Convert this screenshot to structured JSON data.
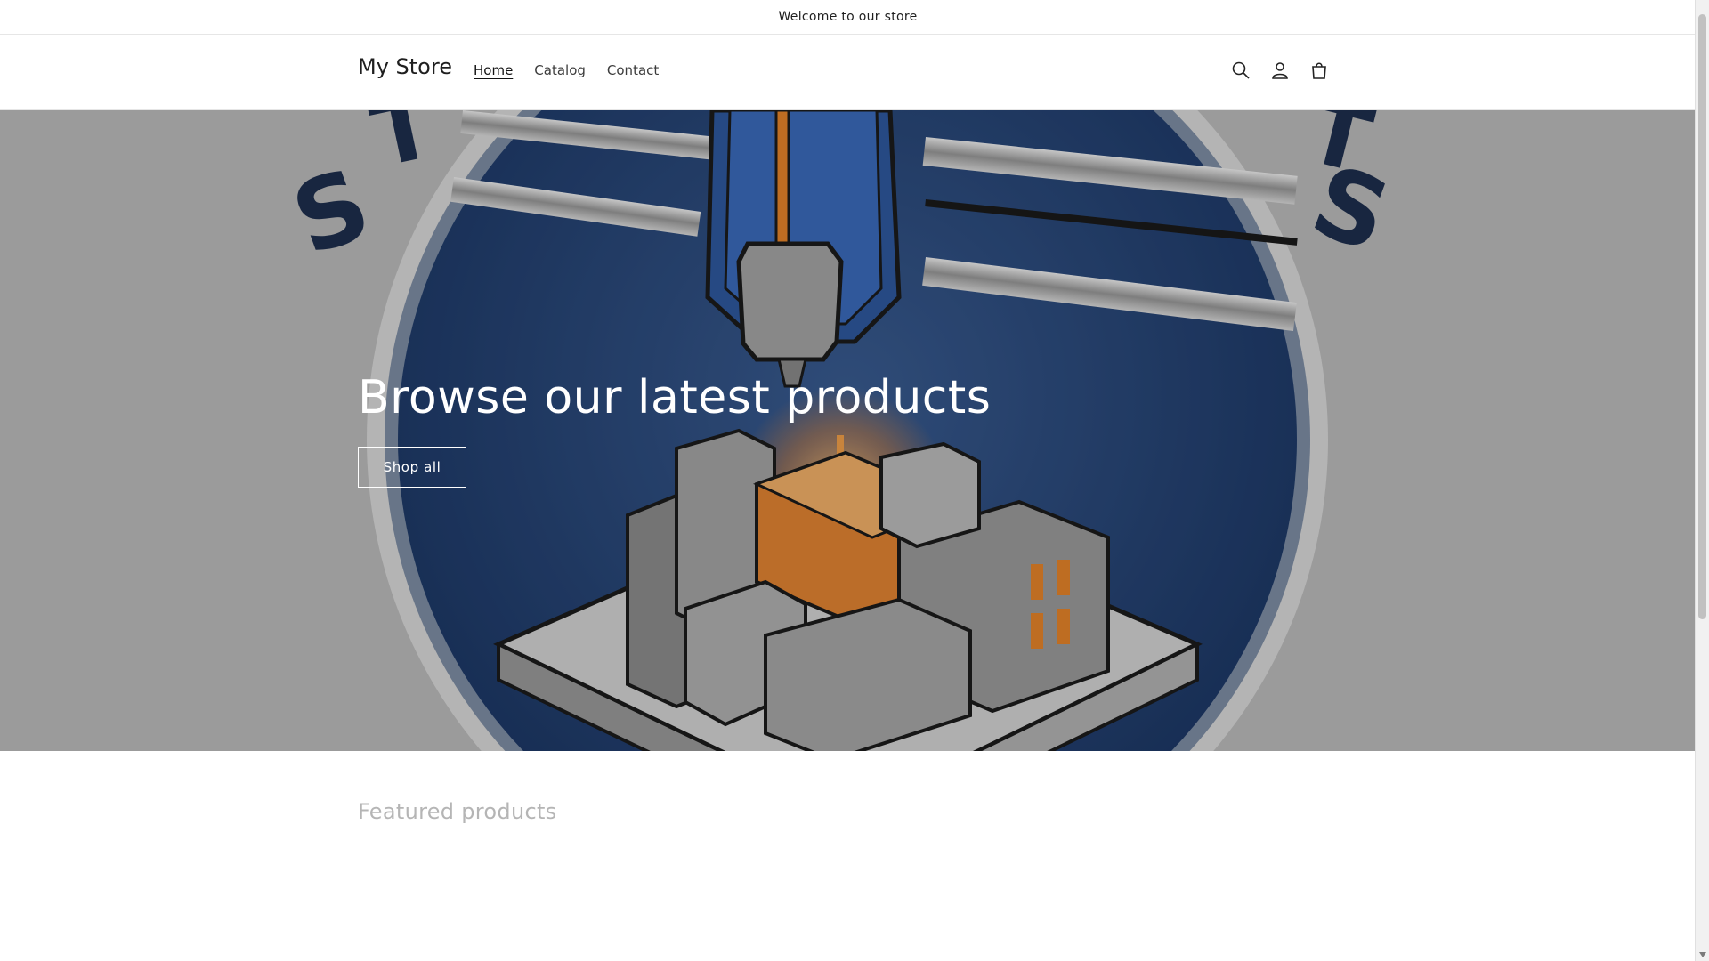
{
  "announcement": {
    "text": "Welcome to our store"
  },
  "header": {
    "logo": "My Store",
    "nav": [
      {
        "label": "Home",
        "active": true
      },
      {
        "label": "Catalog",
        "active": false
      },
      {
        "label": "Contact",
        "active": false
      }
    ],
    "icons": [
      "search-icon",
      "account-icon",
      "cart-icon"
    ]
  },
  "hero": {
    "title": "Browse our latest products",
    "button_label": "Shop all"
  },
  "featured": {
    "title": "Featured products"
  },
  "colors": {
    "hero_blue": "#1f3d6e",
    "accent_orange": "#e8862a",
    "text_dark": "#121212"
  }
}
